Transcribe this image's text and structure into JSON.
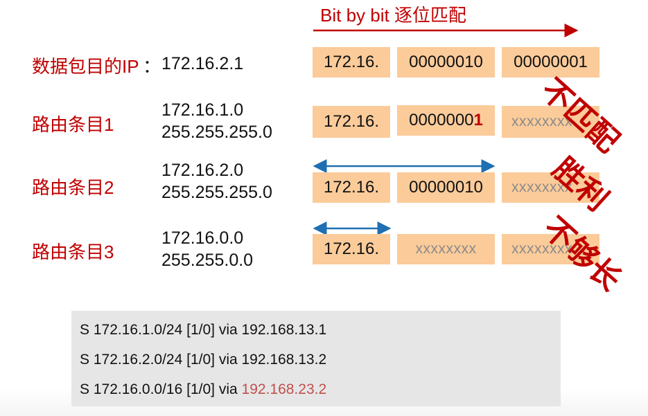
{
  "header": {
    "title": "Bit by bit 逐位匹配"
  },
  "dest": {
    "label": "数据包目的IP",
    "colon": "：",
    "ip": "172.16.2.1",
    "cells": [
      "172.16.",
      "00000010",
      "00000001"
    ]
  },
  "entries": [
    {
      "label": "路由条目1",
      "net": "172.16.1.0",
      "mask": "255.255.255.0",
      "cell1": "172.16.",
      "cell2_prefix": "0000000",
      "cell2_hl": "1",
      "cell3": "xxxxxxxx",
      "stamp": "不匹配"
    },
    {
      "label": "路由条目2",
      "net": "172.16.2.0",
      "mask": "255.255.255.0",
      "cell1": "172.16.",
      "cell2": "00000010",
      "cell3": "xxxxxxxx",
      "stamp": "胜利"
    },
    {
      "label": "路由条目3",
      "net": "172.16.0.0",
      "mask": "255.255.0.0",
      "cell1": "172.16.",
      "cell2": "xxxxxxxx",
      "cell3": "xxxxxxxx",
      "stamp": "不够长"
    }
  ],
  "routes": [
    {
      "text": "S  172.16.1.0/24 [1/0] via 192.168.13.1",
      "via": ""
    },
    {
      "text": "S  172.16.2.0/24 [1/0] via 192.168.13.2",
      "via": ""
    },
    {
      "text": "S  172.16.0.0/16 [1/0] via ",
      "via": "192.168.23.2"
    }
  ],
  "colors": {
    "red": "#c00000",
    "arrow_blue": "#1f6fb2",
    "cell": "#fbcb9a",
    "route_box": "#e6e6e6",
    "via_red": "#c0504d"
  }
}
